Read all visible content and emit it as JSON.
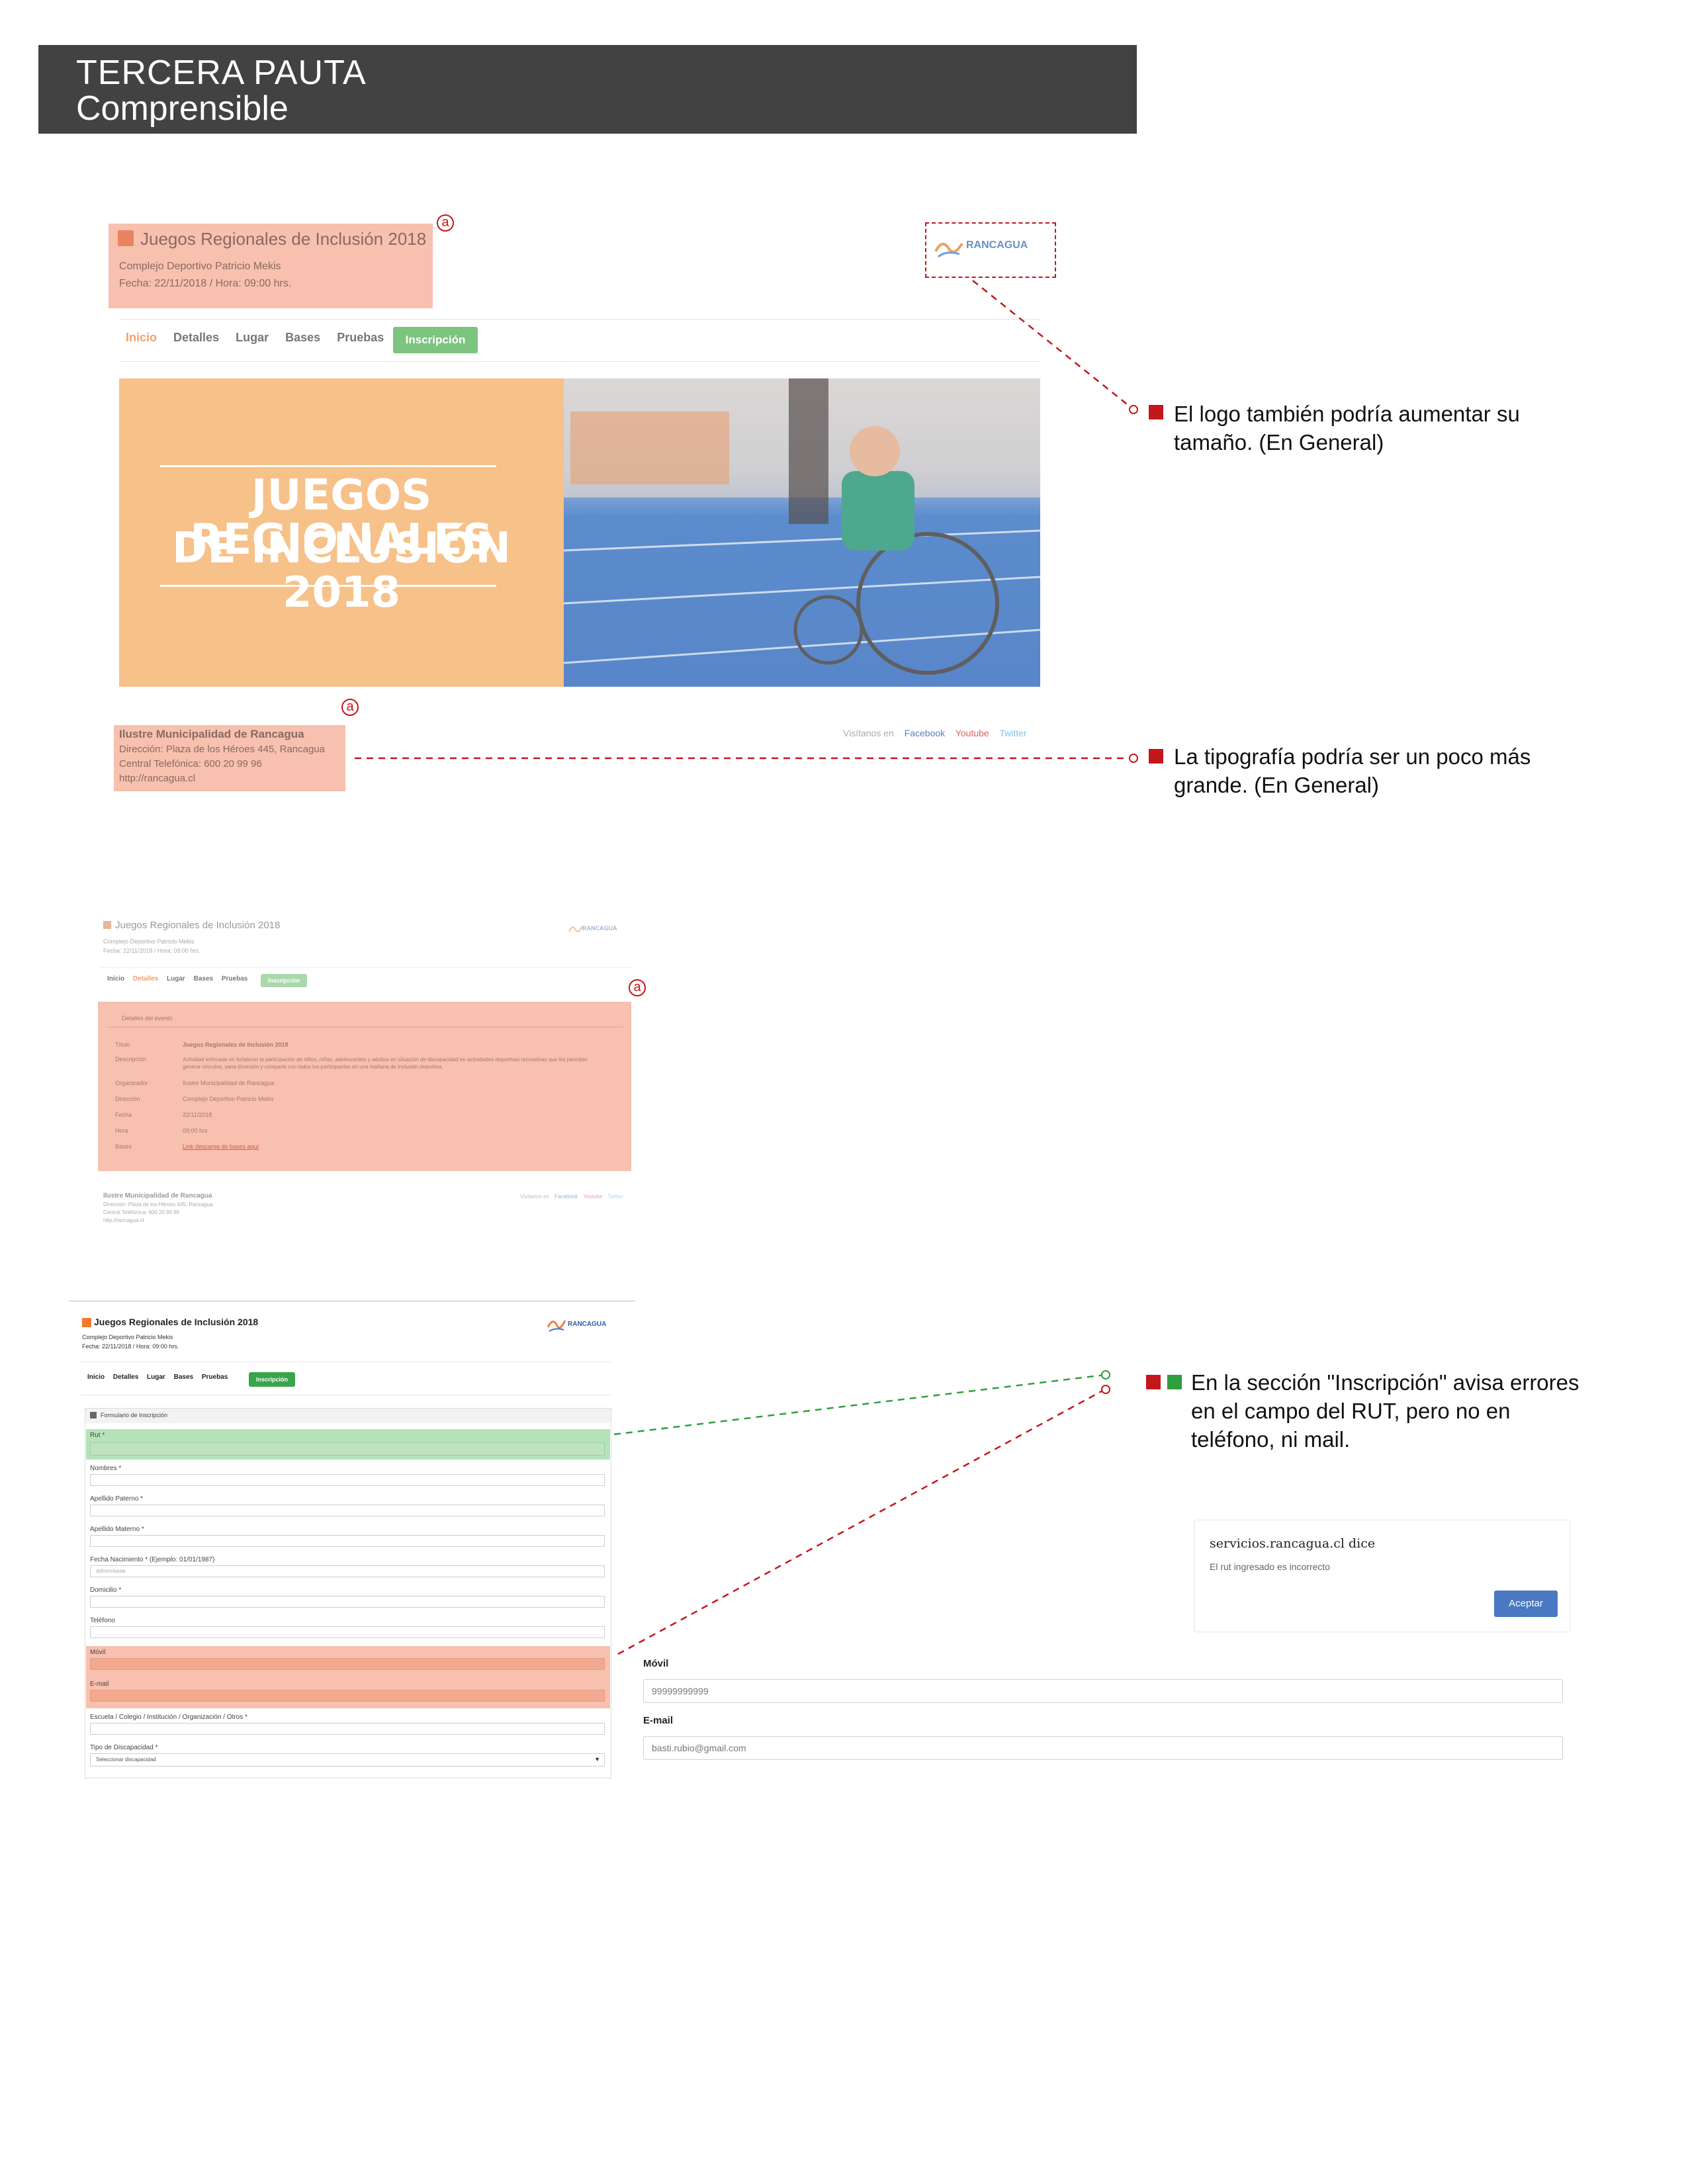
{
  "header": {
    "title": "TERCERA PAUTA",
    "subtitle": "Comprensible"
  },
  "shot1": {
    "site_title": "Juegos Regionales de Inclusión 2018",
    "venue": "Complejo Deportivo Patricio Mekis",
    "date": "Fecha: 22/11/2018 / Hora: 09:00 hrs.",
    "logo": "RANCAGUA",
    "nav": [
      "Inicio",
      "Detalles",
      "Lugar",
      "Bases",
      "Pruebas"
    ],
    "nav_button": "Inscripción",
    "banner_line1": "JUEGOS REGIONALES",
    "banner_line2": "DE INCLUSIÓN 2018",
    "footer_org": "Ilustre Municipalidad de Rancagua",
    "footer_addr": "Dirección: Plaza de los Héroes 445, Rancagua",
    "footer_phone": "Central Telefónica: 600 20 99 96",
    "footer_url": "http://rancagua.cl",
    "social_label": "Visítanos en",
    "social": [
      "Facebook",
      "Youtube",
      "Twitter"
    ],
    "marker": "a"
  },
  "notes": {
    "logo": "El logo también podría aumentar su tamaño. (En General)",
    "typo": "La tipografía podría ser un poco más grande. (En General)",
    "form": "En la sección \"Inscripción\" avisa errores en el campo del RUT, pero no en teléfono, ni mail."
  },
  "shot2": {
    "site_title": "Juegos Regionales de Inclusión 2018",
    "venue": "Complejo Deportivo Patricio Mekis",
    "date": "Fecha: 22/11/2018 / Hora: 09:00 hrs.",
    "logo": "RANCAGUA",
    "nav": [
      "Inicio",
      "Detalles",
      "Lugar",
      "Bases",
      "Pruebas"
    ],
    "nav_button": "Inscripción",
    "panel_title": "Detalles del evento",
    "rows": [
      {
        "k": "Título",
        "v": "Juegos Regionales de Inclusión 2018"
      },
      {
        "k": "Descripción",
        "v": "Actividad enfocada en fortalecer la participación de niños, niñas, adolescentes y adultos en situación de discapacidad en actividades deportivas recreativas que les permitan generar vínculos, sana diversión y compartir con todos los participantes en una mañana de inclusión deportiva."
      },
      {
        "k": "Organizador",
        "v": "Ilustre Municipalidad de Rancagua"
      },
      {
        "k": "Dirección",
        "v": "Complejo Deportivo Patricio Mekis"
      },
      {
        "k": "Fecha",
        "v": "22/11/2018"
      },
      {
        "k": "Hora",
        "v": "09:00 hrs"
      },
      {
        "k": "Bases",
        "v": "Link descarga de bases aquí"
      }
    ],
    "footer_org": "Ilustre Municipalidad de Rancagua",
    "footer_addr": "Dirección: Plaza de los Héroes 445, Rancagua",
    "footer_phone": "Central Telefónica: 600 20 99 96",
    "footer_url": "http://rancagua.cl",
    "social_label": "Visítanos en",
    "social": [
      "Facebook",
      "Youtube",
      "Twitter"
    ],
    "marker": "a"
  },
  "shot3": {
    "site_title": "Juegos Regionales de Inclusión 2018",
    "venue": "Complejo Deportivo Patricio Mekis",
    "date": "Fecha: 22/11/2018 / Hora: 09:00 hrs.",
    "logo": "RANCAGUA",
    "nav": [
      "Inicio",
      "Detalles",
      "Lugar",
      "Bases",
      "Pruebas"
    ],
    "nav_button": "Inscripción",
    "panel_title": "Formulario de Inscripción",
    "fields": [
      "Rut *",
      "Nombres *",
      "Apellido Paterno *",
      "Apellido Materno *",
      "Fecha Nacimiento * (Ejemplo: 01/01/1987)",
      "Domicilio *",
      "Teléfono",
      "Móvil",
      "E-mail",
      "Escuela / Colegio / Institución / Organización / Otros *",
      "Tipo de Discapacidad *"
    ],
    "date_placeholder": "dd/mm/aaaa",
    "select_value": "Seleccionar discapacidad"
  },
  "dialog": {
    "title": "servicios.rancagua.cl dice",
    "message": "El rut ingresado es incorrecto",
    "button": "Aceptar"
  },
  "detail": {
    "movil_label": "Móvil",
    "movil_value": "99999999999",
    "email_label": "E-mail",
    "email_value": "basti.rubio@gmail.com"
  },
  "colors": {
    "red": "#c4161c",
    "green": "#2e9e3e",
    "header": "#424242",
    "highlight": "#f08c6e"
  }
}
